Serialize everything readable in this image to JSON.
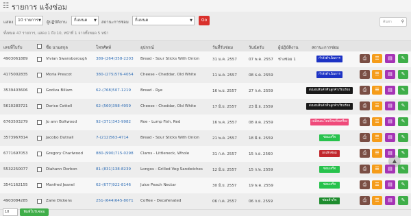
{
  "header": {
    "title": "รายการ แจ้งซ่อม",
    "icon": "list-icon"
  },
  "filters": {
    "show_label": "แสดง",
    "show_value": "10 รายการ",
    "owner_label": "ผู้ปฏิบัติงาน",
    "owner_value": "กี่แหนด",
    "status_label": "สถานะการซ่อม",
    "status_value": "กี่แหนด",
    "go_label": "Go",
    "search_placeholder": "ค้นหา"
  },
  "info_text": "ทั้งหมด 47 รายการ, แสดง 1 ถึง 10, หน้าที่ 1 จากทั้งหมด 5 หน้า",
  "table": {
    "headers": {
      "receipt": "เลขที่ใบรับ",
      "name": "ชื่อ นามสกุล",
      "phone": "โทรศัพท์",
      "device": "อุปกรณ์",
      "repair_date": "วันที่รับซ่อม",
      "due_date": "วันนัดรับ",
      "operator": "ผู้ปฏิบัติงาน",
      "status": "สถานะการซ่อม"
    },
    "rows": [
      {
        "receipt": "4903061889",
        "name": "Vivian Swansborough",
        "phone": "389-(264)358-2203",
        "device": "Bread - Sour Sticks With Onion",
        "repair_date": "31 ม.ค. 2557",
        "due_date": "07 พ.ค. 2557",
        "operator": "ช่างซ่อม 1",
        "status": "กำลังดำเนินการ"
      },
      {
        "receipt": "4175002835",
        "name": "Moria Prescot",
        "phone": "380-(275)576-4054",
        "device": "Cheese - Cheddar, Old White",
        "repair_date": "11 ม.ค. 2557",
        "due_date": "08 ธ.ค. 2559",
        "operator": "",
        "status": "กำลังดำเนินการ"
      },
      {
        "receipt": "3539403606",
        "name": "Godiva Billam",
        "phone": "62-(768)507-1219",
        "device": "Bread - Rye",
        "repair_date": "16 พ.ย. 2557",
        "due_date": "27 ก.ค. 2559",
        "operator": "",
        "status": "ส่งมอบสินค้าคืนลูกค้าเรียบร้อย"
      },
      {
        "receipt": "5610283721",
        "name": "Dorice Cettell",
        "phone": "62-(560)398-4959",
        "device": "Cheese - Cheddar, Old White",
        "repair_date": "17 มิ.ย. 2557",
        "due_date": "23 มิ.ย. 2559",
        "operator": "",
        "status": "ส่งมอบสินค้าคืนลูกค้าเรียบร้อย"
      },
      {
        "receipt": "6763503279",
        "name": "Jo ann Boltwood",
        "phone": "92-(371)343-9982",
        "device": "Roe - Lump Fish, Red",
        "repair_date": "16 พ.ค. 2557",
        "due_date": "08 ส.ค. 2559",
        "operator": "",
        "status": "เปลี่ยนอะไหล่ใหม่ทั้งเครื่อง"
      },
      {
        "receipt": "3573967814",
        "name": "Jacobo Dutnall",
        "phone": "7-(212)563-4714",
        "device": "Bread - Sour Sticks With Onion",
        "repair_date": "21 พ.ค. 2557",
        "due_date": "18 มิ.ย. 2559",
        "operator": "",
        "status": "ซ่อมเสร็จ"
      },
      {
        "receipt": "6771697053",
        "name": "Gregory Charlwood",
        "phone": "880-(990)715-0298",
        "device": "Clams - Littleneck, Whole",
        "repair_date": "31 ก.ค. 2557",
        "due_date": "15 ก.ย. 2560",
        "operator": "",
        "status": "ยกเลิกซ่อม"
      },
      {
        "receipt": "5532250077",
        "name": "Diahann Dorbon",
        "phone": "81-(831)138-8239",
        "device": "Longos - Grilled Veg Sandwiches",
        "repair_date": "12 มิ.ย. 2557",
        "due_date": "15 ก.พ. 2559",
        "operator": "",
        "status": "ซ่อมเสร็จ"
      },
      {
        "receipt": "3541162155",
        "name": "Manfred Jeanel",
        "phone": "62-(677)922-8146",
        "device": "Juice Peach Nectar",
        "repair_date": "30 มิ.ย. 2557",
        "due_date": "19 พ.ค. 2559",
        "operator": "",
        "status": "ซ่อมเสร็จ"
      },
      {
        "receipt": "4903084285",
        "name": "Zane Dickens",
        "phone": "251-(644)645-8071",
        "device": "Coffee - Decafenated",
        "repair_date": "06 ก.ค. 2557",
        "due_date": "06 ก.ย. 2559",
        "operator": "",
        "status": "ซ่อมสำเร็จ"
      }
    ]
  },
  "status_colors": {
    "processing": "#1d33c4",
    "delivered": "#1a1a1a",
    "replaced": "#ef4a7a",
    "done": "#27c24c",
    "cancelled": "#c1272d",
    "success": "#1e8c2e"
  },
  "action_icons": [
    "printer-icon",
    "list-icon",
    "document-icon",
    "edit-icon"
  ],
  "footer": {
    "page_size": "10",
    "button_label": "พิมพ์ใบรับซ่อม"
  }
}
